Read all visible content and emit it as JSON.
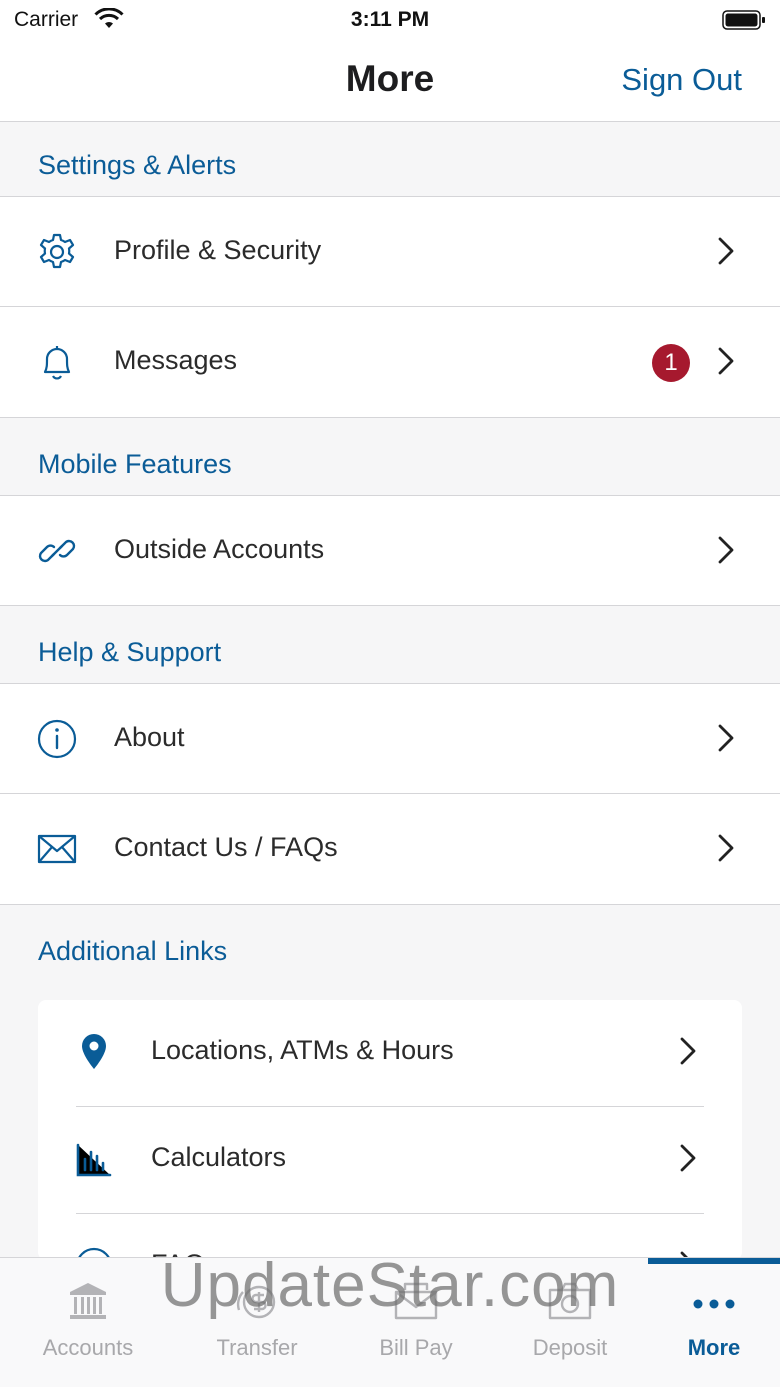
{
  "status_bar": {
    "carrier": "Carrier",
    "time": "3:11 PM"
  },
  "nav": {
    "title": "More",
    "sign_out": "Sign Out"
  },
  "sections": {
    "settings": {
      "header": "Settings & Alerts",
      "items": [
        {
          "label": "Profile & Security",
          "icon": "gear-icon"
        },
        {
          "label": "Messages",
          "icon": "bell-icon",
          "badge": "1"
        }
      ]
    },
    "mobile": {
      "header": "Mobile Features",
      "items": [
        {
          "label": "Outside Accounts",
          "icon": "link-icon"
        }
      ]
    },
    "help": {
      "header": "Help & Support",
      "items": [
        {
          "label": "About",
          "icon": "info-icon"
        },
        {
          "label": "Contact Us / FAQs",
          "icon": "envelope-icon"
        }
      ]
    },
    "additional": {
      "header": "Additional Links",
      "items": [
        {
          "label": "Locations, ATMs & Hours",
          "icon": "location-pin-icon"
        },
        {
          "label": "Calculators",
          "icon": "bar-chart-icon"
        },
        {
          "label": "FAQs",
          "icon": "question-icon"
        }
      ]
    }
  },
  "tabs": [
    {
      "label": "Accounts",
      "icon": "bank-icon"
    },
    {
      "label": "Transfer",
      "icon": "transfer-dollar-icon"
    },
    {
      "label": "Bill Pay",
      "icon": "bill-envelope-icon"
    },
    {
      "label": "Deposit",
      "icon": "camera-check-icon"
    },
    {
      "label": "More",
      "icon": "more-dots-icon",
      "active": true
    }
  ],
  "watermark": "UpdateStar.com",
  "colors": {
    "accent": "#0a5c97",
    "badge": "#a6192e",
    "inactive_tab": "#a8a8ab"
  }
}
